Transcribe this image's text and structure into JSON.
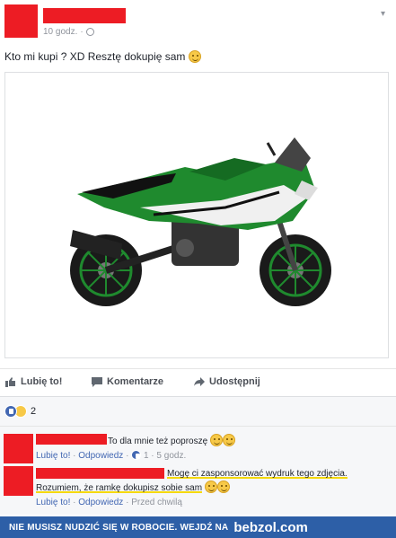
{
  "post": {
    "time": "10 godz.",
    "text": "Kto mi kupi ? XD Resztę dokupię sam"
  },
  "actions": {
    "like": "Lubię to!",
    "comment": "Komentarze",
    "share": "Udostępnij"
  },
  "reactions": {
    "count": "2"
  },
  "comments": [
    {
      "text": "To dla mnie też poproszę",
      "like": "Lubię to!",
      "reply": "Odpowiedz",
      "likes": "1",
      "time": "5 godz."
    },
    {
      "text_line1": "Mogę ci zasponsorować wydruk tego zdjęcia.",
      "text_line2": "Rozumiem, że ramkę dokupisz sobie sam",
      "like": "Lubię to!",
      "reply": "Odpowiedz",
      "time": "Przed chwilą"
    }
  ],
  "banner": {
    "text": "NIE MUSISZ NUDZIĆ SIĘ W ROBOCIE. WEJDŹ NA",
    "logo": "bebzol.com"
  },
  "colors": {
    "redaction": "#ed1c24",
    "link": "#4267b2",
    "banner": "#2d5fa7",
    "highlight": "#f5d90a",
    "moto_green": "#1f8a2e"
  }
}
